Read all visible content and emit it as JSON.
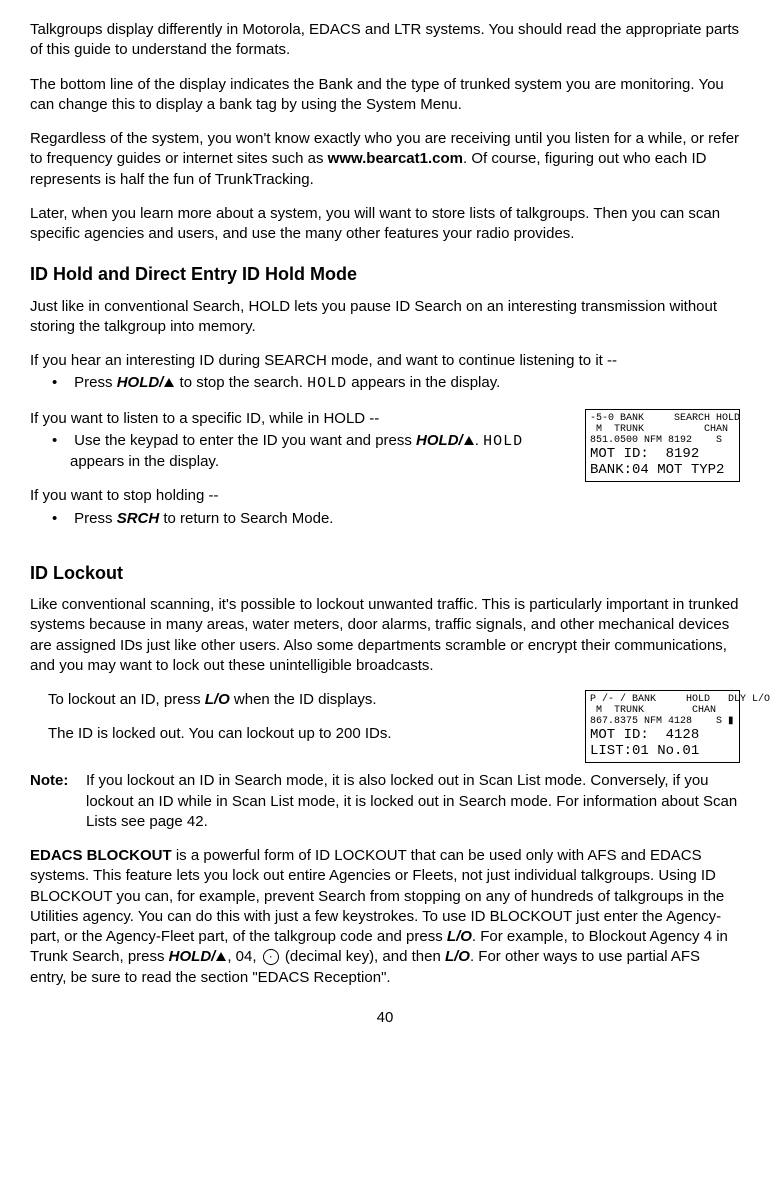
{
  "p": {
    "intro1": "Talkgroups display differently in Motorola, EDACS and LTR systems. You should read the appropriate parts of this guide to understand the formats.",
    "intro2": "The bottom line of the display indicates the Bank and the type of trunked system you are monitoring. You can change this to display a bank tag by using the System Menu.",
    "intro3a": "Regardless of the system, you won't know exactly who you are receiving until you listen for a while, or refer to frequency guides or internet sites such as ",
    "intro3url": "www.bearcat1.com",
    "intro3b": ". Of course, figuring out who each ID represents is half the fun of TrunkTracking.",
    "intro4": "Later, when you learn more about a system, you will want to store lists of talkgroups. Then you can scan specific agencies and users, and use the many other features your radio provides."
  },
  "h": {
    "hold": "ID Hold and Direct Entry ID Hold Mode",
    "lockout": "ID Lockout"
  },
  "hold": {
    "p1": "Just like in conventional Search, HOLD lets you pause ID Search on an interesting transmission without storing the talkgroup into memory.",
    "lead1": "If you hear an interesting ID during SEARCH mode, and want to continue listening to it --",
    "li1a": "Press ",
    "li1key": "HOLD/",
    "li1b": " to stop the search. ",
    "li1lcd": "HOLD",
    "li1c": " appears in the display.",
    "lead2": "If you want to listen to a specific ID, while in HOLD --",
    "li2a": "Use the keypad to enter the ID you want and press ",
    "li2key": "HOLD/",
    "li2b": ". ",
    "li2lcd": "HOLD",
    "li2c": " appears in the display.",
    "lead3": "If you want to stop holding --",
    "li3a": "Press ",
    "li3key": "SRCH",
    "li3b": " to return to Search Mode."
  },
  "box1": {
    "line1": "-5-0 BANK     SEARCH HOLD",
    "line2": " M  TRUNK          CHAN",
    "line3": "851.0500 NFM 8192    S",
    "big1": "MOT ID:  8192",
    "big2": "BANK:04 MOT TYP2"
  },
  "lockout": {
    "p1": "Like conventional scanning, it's possible to lockout unwanted traffic. This is particularly important in trunked systems because in many areas, water meters, door alarms, traffic signals, and other mechanical devices are assigned IDs just like other users. Also some departments scramble or encrypt their communications, and you may want to lock out these unintelligible broadcasts.",
    "p2a": "To lockout an ID, press ",
    "p2key": "L/O",
    "p2b": " when the ID displays.",
    "p3": "The ID is locked out. You can lockout up to 200 IDs.",
    "noteLabel": "Note:",
    "noteBody": "If you lockout an ID in Search mode, it is also locked out in Scan List mode. Conversely, if you lockout an ID while in Scan List mode, it is locked out in Search mode. For information about Scan Lists see page 42.",
    "edacs": {
      "lead": "EDACS BLOCKOUT",
      "t1": " is a powerful form of ID LOCKOUT that can be used only with AFS and EDACS systems. This feature lets you lock out entire Agencies or Fleets, not just individual talkgroups. Using ID BLOCKOUT you can, for example, prevent Search from stopping on any of hundreds of talkgroups in the Utilities agency. You can do this with just a few keystrokes. To use ID BLOCKOUT just enter the Agency- part, or the Agency-Fleet part, of the talkgroup code and press ",
      "k1": "L/O",
      "t2": ". For example, to Blockout Agency 4 in Trunk Search, press ",
      "k2": "HOLD/",
      "t3": ", 04, ",
      "t4": " (decimal key), and then ",
      "k3": "L/O",
      "t5": ". For other ways to use partial AFS entry, be sure to read the section \"EDACS Reception\"."
    }
  },
  "box2": {
    "line1": "P /- / BANK     HOLD   DLY L/O LINE",
    "line2": " M  TRUNK        CHAN",
    "line3": "867.8375 NFM 4128    S ▮",
    "big1": "MOT ID:  4128",
    "big2": "LIST:01 No.01"
  },
  "pageNumber": "40"
}
